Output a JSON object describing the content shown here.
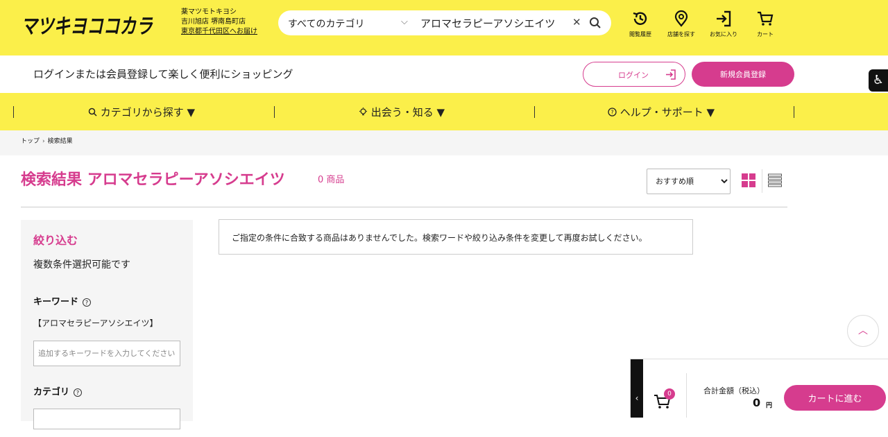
{
  "header": {
    "logo_text": "マツキヨココカラ",
    "store": {
      "line1": "薬マツモトキヨシ",
      "line2": "吉川旭店 堺南島町店",
      "line3": "東京都千代田区へお届け"
    },
    "search": {
      "category": "すべてのカテゴリ",
      "value": "アロマセラピーアソシエイツ",
      "placeholder": ""
    },
    "icons": [
      {
        "icon": "history-icon",
        "label": "閲覧履歴"
      },
      {
        "icon": "store-pin-icon",
        "label": "店舗を探す"
      },
      {
        "icon": "favorite-icon",
        "label": "お気に入り"
      },
      {
        "icon": "cart-icon",
        "label": "カート"
      }
    ]
  },
  "loginbar": {
    "message": "ログインまたは会員登録して楽しく便利にショッピング",
    "login_label": "ログイン",
    "register_label": "新規会員登録"
  },
  "nav": [
    {
      "label": "カテゴリから探す ▼",
      "icon": "search-icon"
    },
    {
      "label": "出会う・知る ▼",
      "icon": "lightbulb-icon"
    },
    {
      "label": "ヘルプ・サポート ▼",
      "icon": "help-icon"
    }
  ],
  "breadcrumbs": {
    "home": "トップ",
    "current": "検索結果"
  },
  "results": {
    "title": "検索結果 アロマセラピーアソシエイツ",
    "count": "0 商品",
    "sort_selected": "おすすめ順",
    "empty_message": "ご指定の条件に合致する商品はありませんでした。検索ワードや絞り込み条件を変更して再度お試しください。"
  },
  "sidebar": {
    "title": "絞り込む",
    "subtitle": "複数条件選択可能です",
    "keyword_label": "キーワード",
    "keyword_value": "【アロマセラピーアソシエイツ】",
    "keyword_placeholder": "追加するキーワードを入力してください",
    "category_label": "カテゴリ",
    "help_glyph": "?"
  },
  "cart": {
    "badge": "0",
    "total_label": "合計金額（税込）",
    "amount": "0",
    "currency": "円",
    "proceed_label": "カートに進む"
  },
  "colors": {
    "accent": "#d63c8e",
    "header_bg": "#fbef4a"
  }
}
